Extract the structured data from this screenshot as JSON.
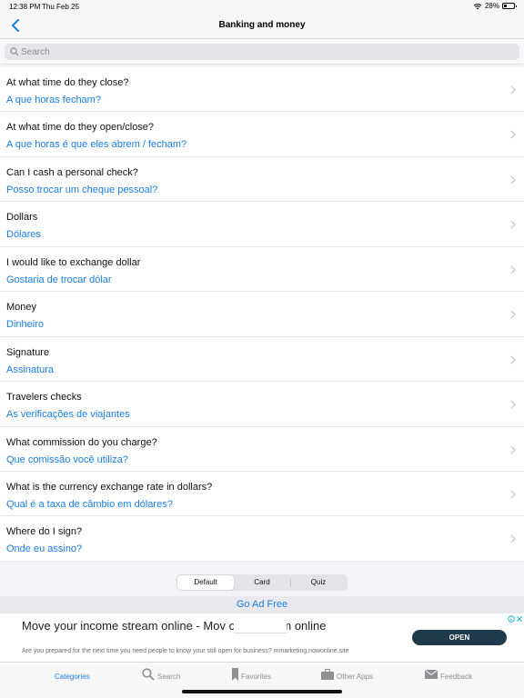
{
  "status_bar": {
    "time": "12:38 PM",
    "date": "Thu Feb 25",
    "battery": "28%"
  },
  "nav": {
    "title": "Banking and money",
    "back_icon": "chevron-left-icon"
  },
  "search": {
    "placeholder": "Search"
  },
  "phrases": [
    {
      "en": "At what time do they close?",
      "pt": "A que horas fecham?"
    },
    {
      "en": "At what time do they open/close?",
      "pt": "A que horas é que eles abrem / fecham?"
    },
    {
      "en": "Can I cash a personal check?",
      "pt": "Posso trocar um cheque pessoal?"
    },
    {
      "en": "Dollars",
      "pt": "Dólares"
    },
    {
      "en": "I would like to exchange dollar",
      "pt": "Gostaria de trocar dólar"
    },
    {
      "en": "Money",
      "pt": "Dinheiro"
    },
    {
      "en": "Signature",
      "pt": "Assinatura"
    },
    {
      "en": "Travelers checks",
      "pt": "As verificações de viajantes"
    },
    {
      "en": "What commission do you charge?",
      "pt": "Que comissão você utiliza?"
    },
    {
      "en": "What is the currency exchange rate in dollars?",
      "pt": "Qual é a taxa de câmbio em dólares?"
    },
    {
      "en": "Where do I sign?",
      "pt": "Onde eu assino?"
    }
  ],
  "segments": {
    "items": [
      "Default",
      "Card",
      "Quiz"
    ],
    "selected": "Default"
  },
  "go_ad_free": "Go Ad Free",
  "ad": {
    "title": "Move your income stream online - Mov                  ome stream online",
    "description": "Are you prepared for the next time you need people to know your still open for business? mmarketing.nowonline.site",
    "button": "OPEN"
  },
  "tabs": [
    {
      "label": "Categories",
      "icon": "categories",
      "active": true
    },
    {
      "label": "Search",
      "icon": "search-icon",
      "active": false
    },
    {
      "label": "Favorites",
      "icon": "bookmark-icon",
      "active": false
    },
    {
      "label": "Other Apps",
      "icon": "briefcase-icon",
      "active": false
    },
    {
      "label": "Feedback",
      "icon": "envelope-icon",
      "active": false
    }
  ],
  "colors": {
    "accent": "#1a7ee6",
    "ad_button": "#1f3a4a",
    "inactive": "#8e8e93"
  }
}
